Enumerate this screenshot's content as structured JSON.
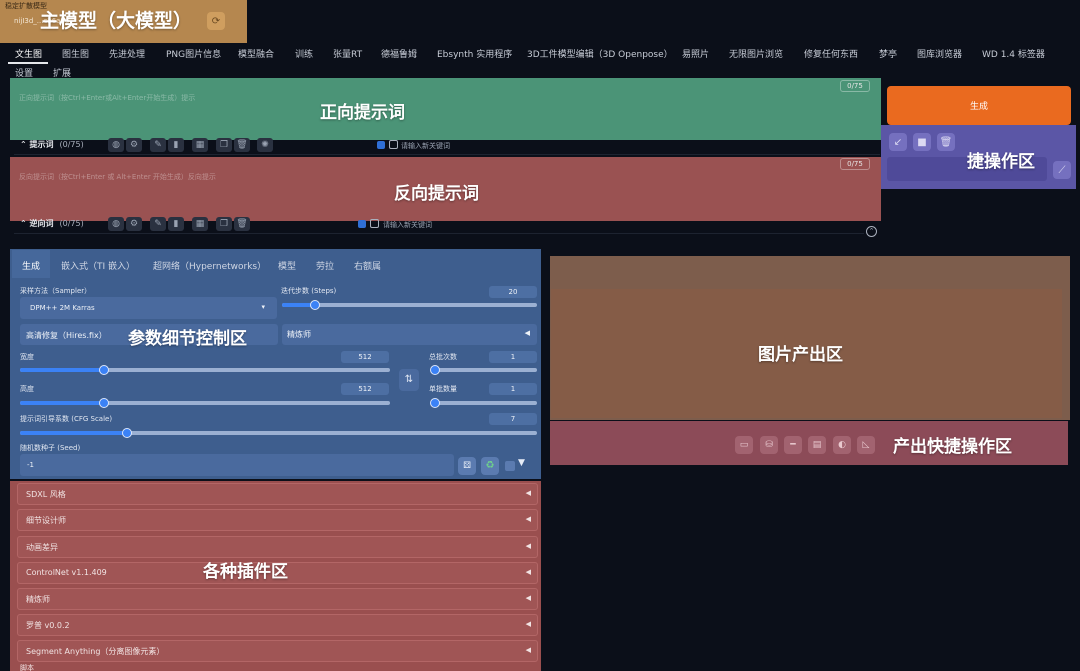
{
  "model": {
    "label": "稳定扩散模型",
    "value": "nijI3d_...cb6a96",
    "overlay": "主模型（大模型）",
    "refresh_icon": "refresh-icon"
  },
  "tabs": [
    {
      "label": "文生图",
      "active": true
    },
    {
      "label": "图生图"
    },
    {
      "label": "先进处理"
    },
    {
      "label": "PNG图片信息"
    },
    {
      "label": "模型融合"
    },
    {
      "label": "训练"
    },
    {
      "label": "张量RT"
    },
    {
      "label": "德福鲁姆"
    },
    {
      "label": "Ebsynth 实用程序"
    },
    {
      "label": "3D工件模型编辑（3D Openpose）"
    },
    {
      "label": "易照片"
    },
    {
      "label": "无限图片浏览"
    },
    {
      "label": "修复任何东西"
    },
    {
      "label": "梦亭"
    },
    {
      "label": "图库浏览器"
    },
    {
      "label": "WD 1.4 标签器"
    },
    {
      "label": "设置"
    },
    {
      "label": "扩展"
    }
  ],
  "positive": {
    "placeholder": "正向提示词（按Ctrl+Enter或Alt+Enter开始生成）提示",
    "counter": "0/75",
    "overlay": "正向提示词",
    "row_label": "提示词",
    "row_count": "(0/75)",
    "keyword_label": "请输入新关键词"
  },
  "negative": {
    "placeholder": "反向提示词（按Ctrl+Enter 或 Alt+Enter 开始生成）反向提示",
    "counter": "0/75",
    "overlay": "反向提示词",
    "row_label": "逆向词",
    "row_count": "(0/75)",
    "keyword_label": "请输入新关键词"
  },
  "generate": {
    "label": "生成"
  },
  "quick_ops": {
    "overlay": "捷操作区"
  },
  "params": {
    "overlay": "参数细节控制区",
    "subtabs": [
      "生成",
      "嵌入式（TI 嵌入）",
      "超网络（Hypernetworks）",
      "模型",
      "劳拉",
      "右额属"
    ],
    "sampler_label": "采样方法（Sampler）",
    "sampler_value": "DPM++ 2M Karras",
    "steps_label": "迭代步数 (Steps)",
    "steps_value": "20",
    "steps": 20,
    "hires_label": "高清修复（Hires.fix）",
    "refiner_label": "精炼师",
    "width_label": "宽度",
    "width_value": "512",
    "width": 512,
    "height_label": "高度",
    "height_value": "512",
    "height": 512,
    "batch_count_label": "总批次数",
    "batch_count_value": "1",
    "batch_size_label": "单批数量",
    "batch_size_value": "1",
    "cfg_label": "提示词引导系数 (CFG Scale)",
    "cfg_value": "7",
    "cfg": 7,
    "seed_label": "随机数种子 (Seed)",
    "seed_value": "-1"
  },
  "output": {
    "overlay": "图片产出区",
    "quick_overlay": "产出快捷操作区"
  },
  "plugins": {
    "overlay": "各种插件区",
    "items": [
      "SDXL 风格",
      "细节设计师",
      "动画差异",
      "ControlNet v1.1.409",
      "精炼师",
      "罗普 v0.0.2",
      "Segment Anything（分离图像元素）"
    ],
    "footer": "脚本"
  },
  "colors": {
    "background": "#0b0f19",
    "model_overlay": "#b5874f",
    "positive_overlay": "#4b9477",
    "negative_overlay": "#9a5252",
    "generate": "#ea6a1f",
    "quick_overlay": "#5b56a6",
    "params_overlay": "#3e5e8e",
    "output_overlay": "#7d5d4c",
    "output_quick_overlay": "#8c4b58",
    "plugins_overlay": "#9a4f4f",
    "accent": "#3b82f6"
  }
}
